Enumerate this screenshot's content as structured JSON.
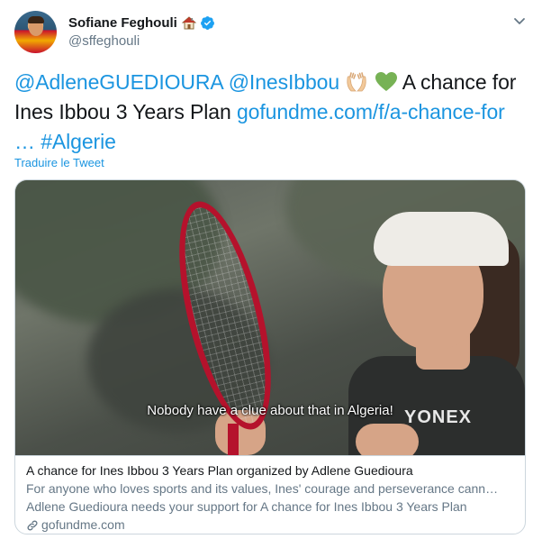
{
  "author": {
    "display_name": "Sofiane Feghouli",
    "handle": "@sffeghouli"
  },
  "tweet": {
    "mention1": "@AdleneGUEDIOURA",
    "mention2": "@InesIbbou",
    "text_after_emojis": " A chance for",
    "text_line2": "Ines Ibbou  3 Years Plan ",
    "link": "gofundme.com/f/a-chance-for",
    "ellipsis": "… ",
    "hashtag": "#Algerie"
  },
  "translate_label": "Traduire le Tweet",
  "card": {
    "subtitle": "Nobody have a clue about that in Algeria!",
    "shirt_brand": "YONEX",
    "title": "A chance for Ines Ibbou 3 Years Plan organized by Adlene Guedioura",
    "desc_line1": "For anyone who loves sports and its values, Ines' courage and perseverance cann…",
    "desc_line2": "Adlene Guedioura needs your support for A chance for Ines Ibbou 3 Years Plan",
    "domain": "gofundme.com"
  },
  "colors": {
    "link": "#1b95e0",
    "verified": "#1da1f2",
    "secondary_text": "#657786",
    "border": "#ccd6dd"
  },
  "icons": {
    "verified": "verified-badge-icon",
    "home": "house-emoji-icon",
    "hands": "palms-up-emoji-icon",
    "heart": "green-heart-emoji-icon",
    "caret": "chevron-down-icon",
    "link": "link-icon"
  }
}
